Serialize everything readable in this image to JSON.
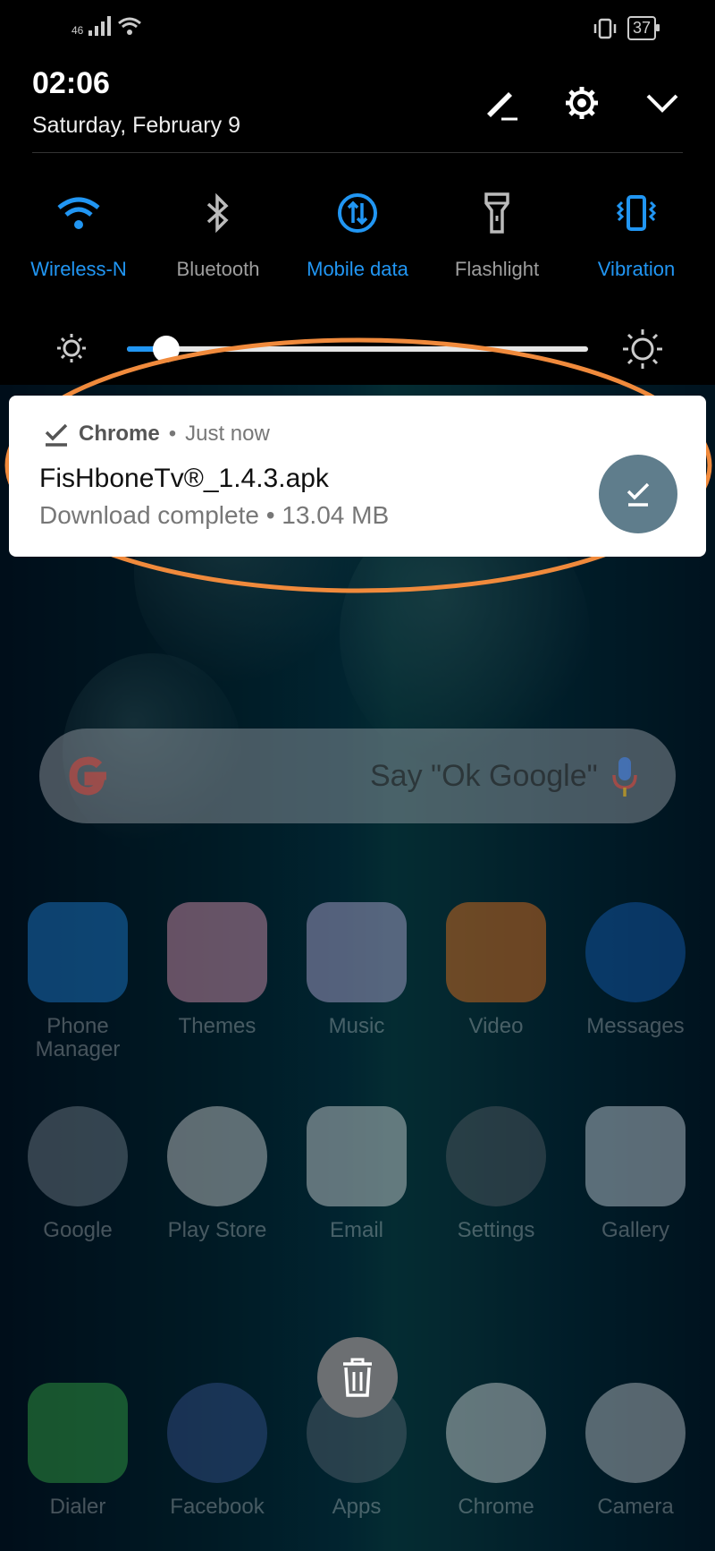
{
  "status_bar": {
    "signal": "46",
    "battery": "37"
  },
  "header": {
    "time": "02:06",
    "date": "Saturday, February 9"
  },
  "quick_toggles": [
    {
      "label": "Wireless-N",
      "state": "on",
      "icon": "wifi-icon"
    },
    {
      "label": "Bluetooth",
      "state": "off",
      "icon": "bluetooth-icon"
    },
    {
      "label": "Mobile data",
      "state": "on",
      "icon": "mobile-data-icon"
    },
    {
      "label": "Flashlight",
      "state": "off",
      "icon": "flashlight-icon"
    },
    {
      "label": "Vibration",
      "state": "on",
      "icon": "vibration-icon"
    }
  ],
  "brightness": {
    "level": 0.06
  },
  "notification": {
    "app": "Chrome",
    "time": "Just now",
    "title": "FisHboneTv®_1.4.3.apk",
    "subtitle": "Download complete • 13.04 MB"
  },
  "search": {
    "placeholder": "Say \"Ok Google\""
  },
  "apps": [
    {
      "label": "Phone\nManager",
      "color": "#1e88e5"
    },
    {
      "label": "Themes",
      "color": "#f4a3c0"
    },
    {
      "label": "Music",
      "color": "#c7b8e6"
    },
    {
      "label": "Video",
      "color": "#ff7a1a"
    },
    {
      "label": "Messages",
      "color": "#1565c0"
    },
    {
      "label": "Google",
      "color": "#7c8894"
    },
    {
      "label": "Play Store",
      "color": "#e0e0e0"
    },
    {
      "label": "Email",
      "color": "#e8e8e8"
    },
    {
      "label": "Settings",
      "color": "#5a6066"
    },
    {
      "label": "Gallery",
      "color": "#d9e3ec"
    },
    {
      "label": "Dialer",
      "color": "#39b54a"
    },
    {
      "label": "Facebook",
      "color": "#3b5998"
    },
    {
      "label": "Apps",
      "color": "#5f6a74"
    },
    {
      "label": "Chrome",
      "color": "#e8e8e8"
    },
    {
      "label": "Camera",
      "color": "#cfd4d8"
    }
  ],
  "colors": {
    "accent": "#2196f3",
    "highlight": "#f08a3c"
  }
}
